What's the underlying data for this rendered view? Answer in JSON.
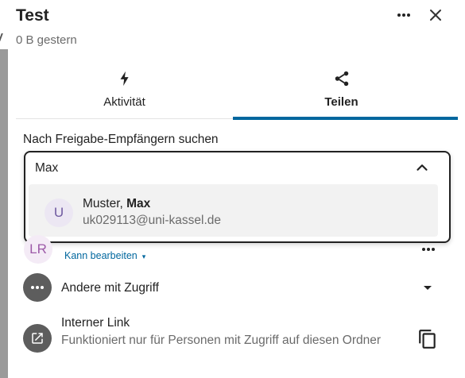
{
  "header": {
    "title": "Test",
    "subtitle": "0 B gestern"
  },
  "tabs": [
    {
      "label": "Aktivität",
      "icon": "bolt-icon",
      "active": false
    },
    {
      "label": "Teilen",
      "icon": "share-icon",
      "active": true
    }
  ],
  "share": {
    "search_label": "Nach Freigabe-Empfängern suchen",
    "search_value": "Max",
    "result": {
      "avatar_letter": "U",
      "name_prefix": "Muster, ",
      "name_bold": "Max",
      "email": "uk029113@uni-kassel.de"
    },
    "member": {
      "avatar_initials": "LR",
      "permission": "Kann bearbeiten",
      "permission_caret": "▾"
    },
    "others_label": "Andere mit Zugriff",
    "internal_link": {
      "title": "Interner Link",
      "description": "Funktioniert nur für Personen mit Zugriff auf diesen Ordner"
    }
  },
  "colors": {
    "accent": "#00679e",
    "text": "#222222",
    "muted": "#6b6b6b",
    "icon_circle": "#5d5d5d",
    "result_bg": "#f2f2f2"
  }
}
